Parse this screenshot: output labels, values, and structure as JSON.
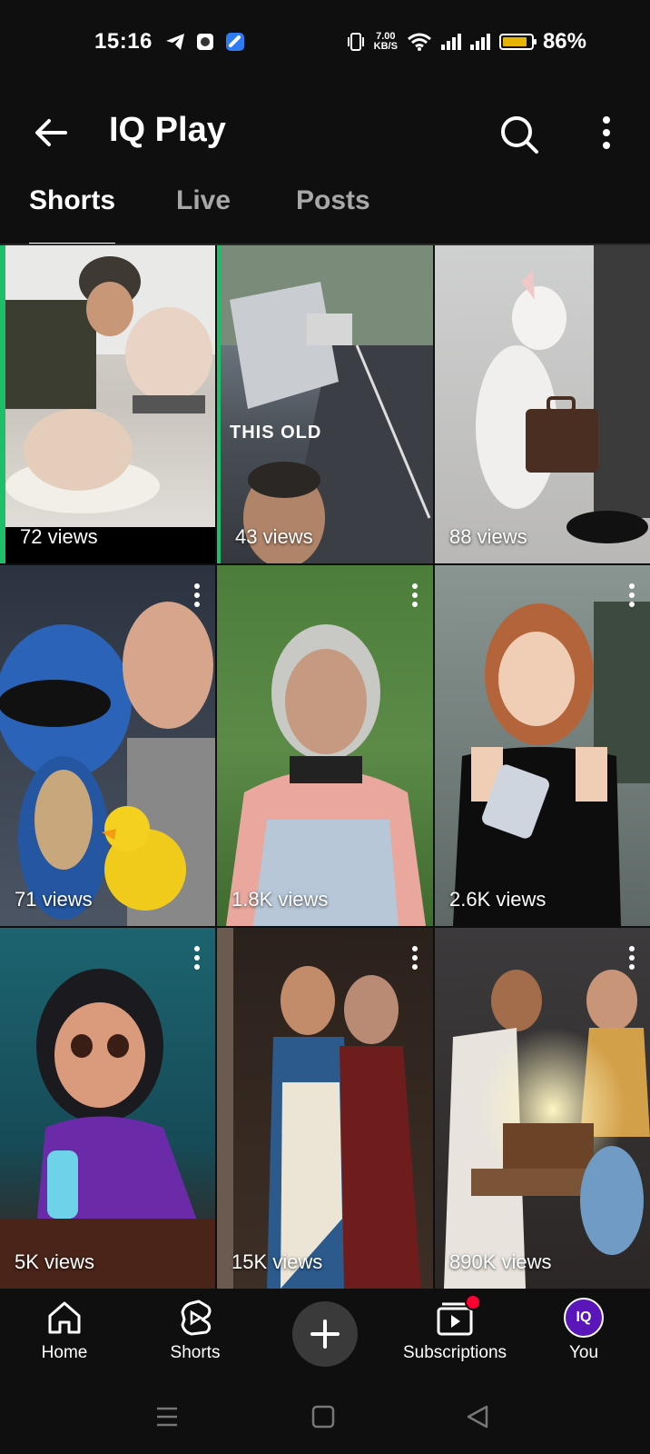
{
  "status_bar": {
    "time": "15:16",
    "speed_value": "7.00",
    "speed_unit": "KB/S",
    "battery": "86%",
    "battery_level": 0.86
  },
  "app_bar": {
    "title": "IQ Play",
    "icons": [
      "back-arrow-icon",
      "search-icon",
      "more-vert-icon"
    ]
  },
  "tabs": [
    {
      "label": "Shorts",
      "active": true
    },
    {
      "label": "Live",
      "active": false
    },
    {
      "label": "Posts",
      "active": false
    }
  ],
  "shorts": [
    {
      "views": "72 views",
      "overlay": ""
    },
    {
      "views": "43 views",
      "overlay": "THIS OLD"
    },
    {
      "views": "88 views",
      "overlay": ""
    },
    {
      "views": "71 views",
      "overlay": ""
    },
    {
      "views": "1.8K views",
      "overlay": ""
    },
    {
      "views": "2.6K views",
      "overlay": ""
    },
    {
      "views": "5K views",
      "overlay": ""
    },
    {
      "views": "15K views",
      "overlay": ""
    },
    {
      "views": "890K views",
      "overlay": ""
    }
  ],
  "bottom_nav": {
    "home": "Home",
    "shorts": "Shorts",
    "subscriptions": "Subscriptions",
    "you": "You",
    "avatar_text": "IQ"
  },
  "colors": {
    "background": "#0f0f0f",
    "badge": "#ff0033",
    "avatar": "#5a16b8",
    "battery": "#e6b400"
  }
}
